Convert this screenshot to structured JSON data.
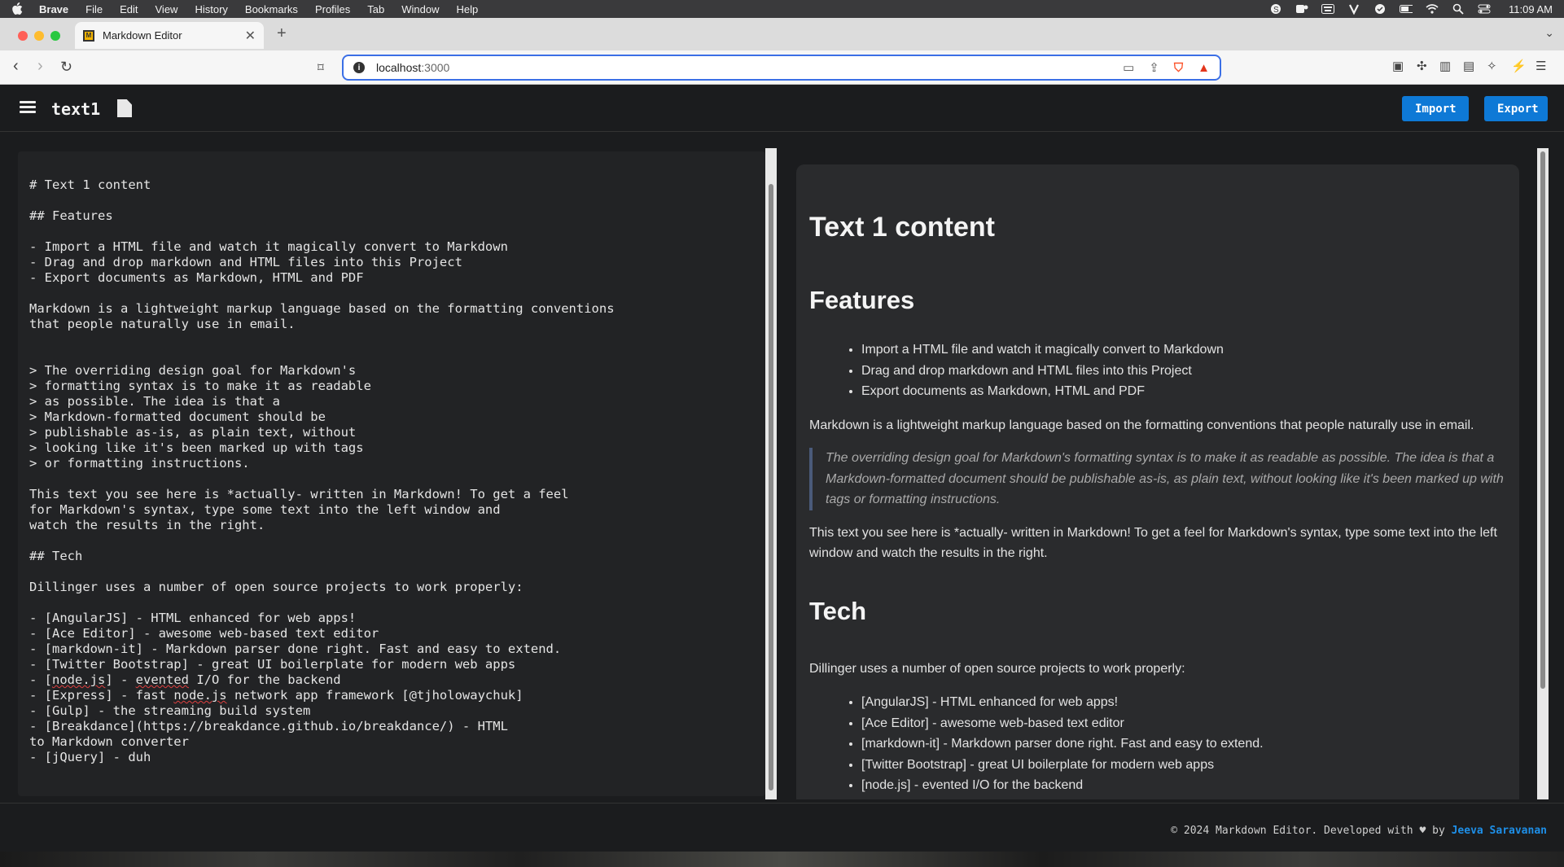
{
  "menubar": {
    "app": "Brave",
    "items": [
      "File",
      "Edit",
      "View",
      "History",
      "Bookmarks",
      "Profiles",
      "Tab",
      "Window",
      "Help"
    ],
    "time": "11:09 AM"
  },
  "browser": {
    "tab_title": "Markdown Editor",
    "url_host": "localhost",
    "url_suffix": ":3000"
  },
  "app": {
    "doc_title": "text1",
    "import_label": "Import",
    "export_label": "Export"
  },
  "editor": {
    "lines": [
      "# Text 1 content",
      "",
      "## Features",
      "",
      "- Import a HTML file and watch it magically convert to Markdown",
      "- Drag and drop markdown and HTML files into this Project",
      "- Export documents as Markdown, HTML and PDF",
      "",
      "Markdown is a lightweight markup language based on the formatting conventions",
      "that people naturally use in email.",
      "",
      "",
      "> The overriding design goal for Markdown's",
      "> formatting syntax is to make it as readable",
      "> as possible. The idea is that a",
      "> Markdown-formatted document should be",
      "> publishable as-is, as plain text, without",
      "> looking like it's been marked up with tags",
      "> or formatting instructions.",
      "",
      "This text you see here is *actually- written in Markdown! To get a feel",
      "for Markdown's syntax, type some text into the left window and",
      "watch the results in the right.",
      "",
      "## Tech",
      "",
      "Dillinger uses a number of open source projects to work properly:",
      "",
      "- [AngularJS] - HTML enhanced for web apps!",
      "- [Ace Editor] - awesome web-based text editor",
      "- [markdown-it] - Markdown parser done right. Fast and easy to extend.",
      "- [Twitter Bootstrap] - great UI boilerplate for modern web apps",
      "- [node.js] - evented I/O for the backend",
      "- [Express] - fast node.js network app framework [@tjholowaychuk]",
      "- [Gulp] - the streaming build system",
      "- [Breakdance](https://breakdance.github.io/breakdance/) - HTML",
      "to Markdown converter",
      "- [jQuery] - duh"
    ]
  },
  "preview": {
    "h1": "Text 1 content",
    "features_heading": "Features",
    "features": [
      "Import a HTML file and watch it magically convert to Markdown",
      "Drag and drop markdown and HTML files into this Project",
      "Export documents as Markdown, HTML and PDF"
    ],
    "intro": "Markdown is a lightweight markup language based on the formatting conventions that people naturally use in email.",
    "quote": "The overriding design goal for Markdown's formatting syntax is to make it as readable as possible. The idea is that a Markdown-formatted document should be publishable as-is, as plain text, without looking like it's been marked up with tags or formatting instructions.",
    "actually": "This text you see here is *actually- written in Markdown! To get a feel for Markdown's syntax, type some text into the left window and watch the results in the right.",
    "tech_heading": "Tech",
    "tech_intro": "Dillinger uses a number of open source projects to work properly:",
    "tech": [
      "[AngularJS] - HTML enhanced for web apps!",
      "[Ace Editor] - awesome web-based text editor",
      "[markdown-it] - Markdown parser done right. Fast and easy to extend.",
      "[Twitter Bootstrap] - great UI boilerplate for modern web apps",
      "[node.js] - evented I/O for the backend"
    ]
  },
  "footer": {
    "text": "© 2024 Markdown Editor. Developed with ♥ by ",
    "author": "Jeeva Saravanan"
  },
  "colors": {
    "accent": "#0e79d6",
    "link": "#1e8fe8",
    "background": "#1b1c1e",
    "editor_bg": "#222325",
    "preview_bg": "#2a2b2d"
  }
}
